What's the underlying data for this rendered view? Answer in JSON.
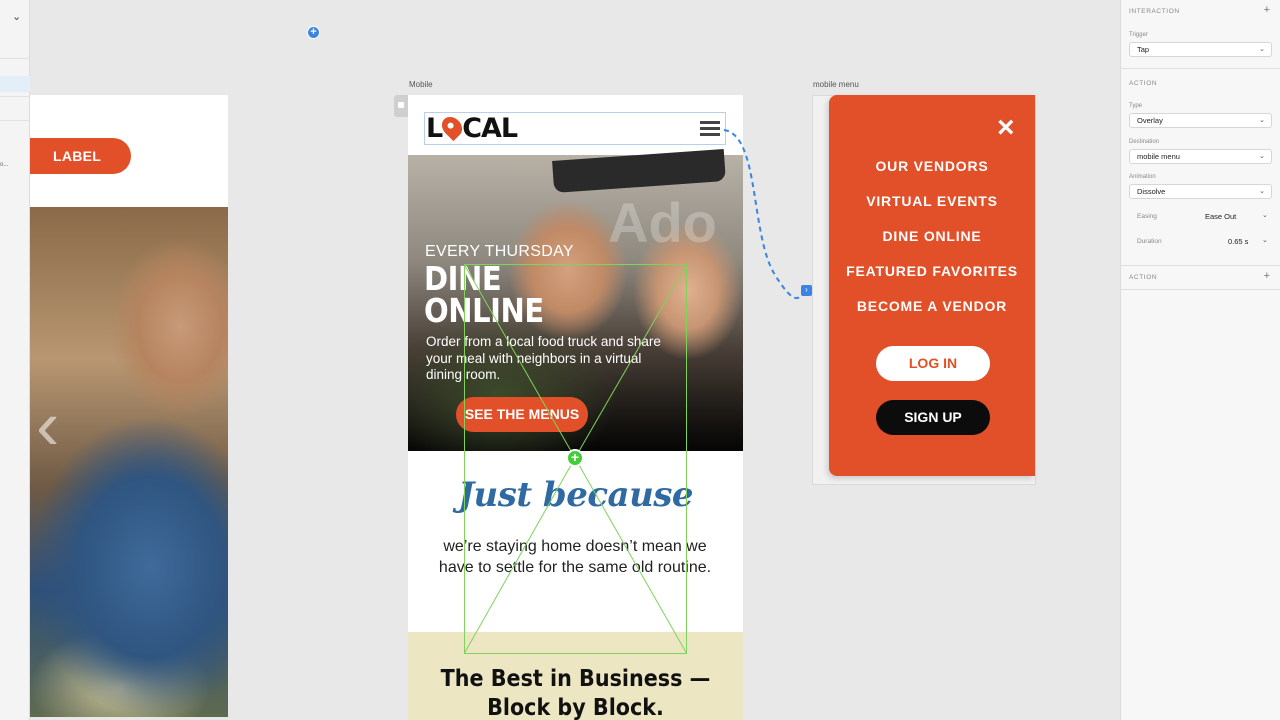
{
  "left_artboard": {
    "label_button": "LABEL"
  },
  "artboard_titles": {
    "mobile": "Mobile",
    "mobile_menu": "mobile menu"
  },
  "mobile": {
    "logo": {
      "pre": "L",
      "post": "CAL"
    },
    "hero": {
      "kicker": "EVERY THURSDAY",
      "title_line1": "DINE",
      "title_line2": "ONLINE",
      "description": "Order from a local food truck and share your meal with neighbors in a virtual dining room.",
      "button": "SEE THE MENUS"
    },
    "just_because": {
      "heading": "Just because",
      "body": "we’re staying home doesn’t mean we have to settle for the same old routine."
    },
    "best": {
      "line1": "The Best in Business —",
      "line2": "Block by Block."
    }
  },
  "mobile_menu": {
    "close_icon": "×",
    "items": [
      "OUR VENDORS",
      "VIRTUAL EVENTS",
      "DINE ONLINE",
      "FEATURED FAVORITES",
      "BECOME A VENDOR"
    ],
    "login": "LOG IN",
    "signup": "SIGN UP"
  },
  "panel": {
    "interaction_header": "INTERACTION",
    "trigger_label": "Trigger",
    "trigger_value": "Tap",
    "action_header": "ACTION",
    "type_label": "Type",
    "type_value": "Overlay",
    "destination_label": "Destination",
    "destination_value": "mobile menu",
    "animation_label": "Animation",
    "animation_value": "Dissolve",
    "easing_label": "Easing",
    "easing_value": "Ease Out",
    "duration_label": "Duration",
    "duration_value": "0.65 s",
    "action2_header": "ACTION"
  },
  "colors": {
    "brand_orange": "#e2502a",
    "link_blue": "#3a84e3",
    "selection_green": "#44cc3a",
    "heading_blue": "#2f6aa3",
    "best_bg": "#ece6c3"
  }
}
